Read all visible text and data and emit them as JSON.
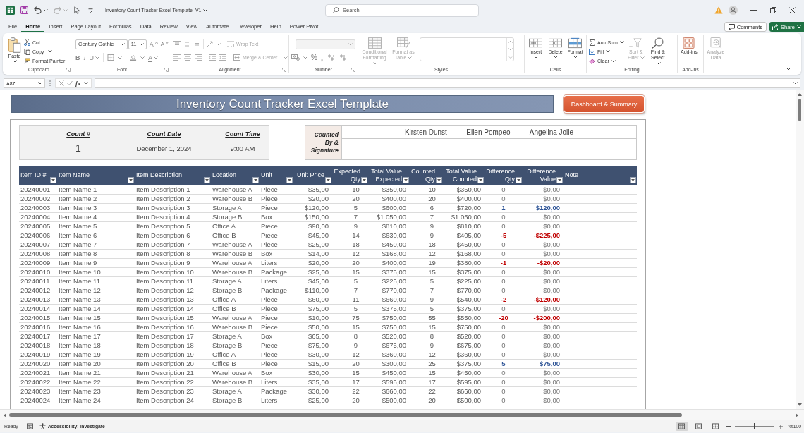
{
  "title_bar": {
    "title": "Inventory Count Tracker Excel Template_V1",
    "redo_disabled": true,
    "search": {
      "placeholder": "Search"
    }
  },
  "menu": {
    "tabs": [
      {
        "label": "File",
        "selected": false
      },
      {
        "label": "Home",
        "selected": true
      },
      {
        "label": "Insert",
        "selected": false
      },
      {
        "label": "Page Layout",
        "selected": false
      },
      {
        "label": "Formulas",
        "selected": false
      },
      {
        "label": "Data",
        "selected": false
      },
      {
        "label": "Review",
        "selected": false
      },
      {
        "label": "View",
        "selected": false
      },
      {
        "label": "Automate",
        "selected": false
      },
      {
        "label": "Developer",
        "selected": false
      },
      {
        "label": "Help",
        "selected": false
      },
      {
        "label": "Power Pivot",
        "selected": false
      }
    ],
    "comments": "Comments",
    "share": "Share"
  },
  "ribbon": {
    "clipboard": {
      "label": "Clipboard",
      "paste": "Paste",
      "cut": "Cut",
      "copy": "Copy",
      "format_painter": "Format Painter"
    },
    "font": {
      "label": "Font",
      "family": "Century Gothic",
      "size": "11",
      "grow": "A",
      "shrink": "A",
      "bold": "B",
      "italic": "I",
      "underline": "U",
      "paint": "A"
    },
    "alignment": {
      "label": "Alignment",
      "wrap_text": {
        "label": "Wrap Text",
        "disabled": true
      },
      "merge": {
        "label": "Merge & Center",
        "disabled": true
      }
    },
    "number": {
      "label": "Number",
      "format_disabled": true,
      "percent": "%",
      "comma": ","
    },
    "styles": {
      "label": "Styles",
      "buttons": [
        {
          "label": "Conditional Formatting",
          "disabled": true
        },
        {
          "label": "Format as Table",
          "disabled": true
        }
      ]
    },
    "cells": {
      "label": "Cells",
      "buttons": [
        {
          "label": "Insert"
        },
        {
          "label": "Delete"
        },
        {
          "label": "Format"
        }
      ]
    },
    "editing": {
      "label": "Editing",
      "small": [
        {
          "label": "AutoSum"
        },
        {
          "label": "Fill"
        },
        {
          "label": "Clear"
        }
      ],
      "buttons": [
        {
          "label": "Sort & Filter",
          "disabled": true
        },
        {
          "label": "Find & Select",
          "disabled": false
        }
      ]
    },
    "addins": {
      "label": "Add-ins",
      "button": "Add-ins"
    },
    "analyze": {
      "label": "Analyze Data",
      "disabled": true
    }
  },
  "formula_bar": {
    "name_box": "A87",
    "function_label": "fx"
  },
  "sheet": {
    "banner": "Inventory Count Tracker Excel Template",
    "dashboard_button": "Dashboard & Summary",
    "count_info": [
      {
        "label": "Count #",
        "value": "1"
      },
      {
        "label": "Count Date",
        "value": "December 1, 2024"
      },
      {
        "label": "Count Time",
        "value": "9:00 AM"
      }
    ],
    "signature": {
      "label": "Counted By & Signature",
      "names": [
        {
          "kind": "name",
          "text": "Kirsten Dunst"
        },
        {
          "kind": "separator",
          "text": "-"
        },
        {
          "kind": "name",
          "text": "Ellen Pompeo"
        },
        {
          "kind": "separator",
          "text": "-"
        },
        {
          "kind": "name",
          "text": "Angelina Jolie"
        }
      ]
    },
    "table": {
      "columns": [
        {
          "label": "Item ID #",
          "kind": "id"
        },
        {
          "label": "Item Name",
          "kind": "text"
        },
        {
          "label": "Item Description",
          "kind": "text"
        },
        {
          "label": "Location",
          "kind": "text"
        },
        {
          "label": "Unit",
          "kind": "text"
        },
        {
          "label": "Unit Price",
          "kind": "money"
        },
        {
          "label": "Expected Qty",
          "kind": "number"
        },
        {
          "label": "Total Value Expected",
          "kind": "money"
        },
        {
          "label": "Counted Qty",
          "kind": "number"
        },
        {
          "label": "Total Value Counted",
          "kind": "money"
        },
        {
          "label": "Difference Qty",
          "kind": "diff_number"
        },
        {
          "label": "Difference Value",
          "kind": "diff_money"
        },
        {
          "label": "Note",
          "kind": "note"
        }
      ],
      "rows": [
        {
          "cells": [
            "20240001",
            "Item Name 1",
            "Item Description 1",
            "Warehouse A",
            "Piece",
            "$35,00",
            "10",
            "$350,00",
            "10",
            "$350,00",
            "0",
            "$0,00"
          ],
          "shortage": false,
          "surplus": false
        },
        {
          "cells": [
            "20240002",
            "Item Name 2",
            "Item Description 2",
            "Warehouse B",
            "Piece",
            "$20,00",
            "20",
            "$400,00",
            "20",
            "$400,00",
            "0",
            "$0,00"
          ],
          "shortage": false,
          "surplus": false
        },
        {
          "cells": [
            "20240003",
            "Item Name 3",
            "Item Description 3",
            "Storage A",
            "Piece",
            "$120,00",
            "5",
            "$600,00",
            "6",
            "$720,00",
            "1",
            "$120,00"
          ],
          "shortage": false,
          "surplus": true
        },
        {
          "cells": [
            "20240004",
            "Item Name 4",
            "Item Description 4",
            "Storage B",
            "Box",
            "$150,00",
            "7",
            "$1.050,00",
            "7",
            "$1.050,00",
            "0",
            "$0,00"
          ],
          "shortage": false,
          "surplus": false
        },
        {
          "cells": [
            "20240005",
            "Item Name 5",
            "Item Description 5",
            "Office A",
            "Piece",
            "$90,00",
            "9",
            "$810,00",
            "9",
            "$810,00",
            "0",
            "$0,00"
          ],
          "shortage": false,
          "surplus": false
        },
        {
          "cells": [
            "20240006",
            "Item Name 6",
            "Item Description 6",
            "Office B",
            "Piece",
            "$45,00",
            "14",
            "$630,00",
            "9",
            "$405,00",
            "-5",
            "-$225,00"
          ],
          "shortage": true,
          "surplus": false
        },
        {
          "cells": [
            "20240007",
            "Item Name 7",
            "Item Description 7",
            "Warehouse A",
            "Piece",
            "$25,00",
            "18",
            "$450,00",
            "18",
            "$450,00",
            "0",
            "$0,00"
          ],
          "shortage": false,
          "surplus": false
        },
        {
          "cells": [
            "20240008",
            "Item Name 8",
            "Item Description 8",
            "Warehouse B",
            "Box",
            "$14,00",
            "12",
            "$168,00",
            "12",
            "$168,00",
            "0",
            "$0,00"
          ],
          "shortage": false,
          "surplus": false
        },
        {
          "cells": [
            "20240009",
            "Item Name 9",
            "Item Description 9",
            "Warehouse A",
            "Liters",
            "$20,00",
            "20",
            "$400,00",
            "19",
            "$380,00",
            "-1",
            "-$20,00"
          ],
          "shortage": true,
          "surplus": false
        },
        {
          "cells": [
            "20240010",
            "Item Name 10",
            "Item Description 10",
            "Warehouse B",
            "Package",
            "$25,00",
            "15",
            "$375,00",
            "15",
            "$375,00",
            "0",
            "$0,00"
          ],
          "shortage": false,
          "surplus": false
        },
        {
          "cells": [
            "20240011",
            "Item Name 11",
            "Item Description 11",
            "Storage A",
            "Liters",
            "$45,00",
            "5",
            "$225,00",
            "5",
            "$225,00",
            "0",
            "$0,00"
          ],
          "shortage": false,
          "surplus": false
        },
        {
          "cells": [
            "20240012",
            "Item Name 12",
            "Item Description 12",
            "Storage B",
            "Package",
            "$110,00",
            "7",
            "$770,00",
            "7",
            "$770,00",
            "0",
            "$0,00"
          ],
          "shortage": false,
          "surplus": false
        },
        {
          "cells": [
            "20240013",
            "Item Name 13",
            "Item Description 13",
            "Office A",
            "Piece",
            "$60,00",
            "11",
            "$660,00",
            "9",
            "$540,00",
            "-2",
            "-$120,00"
          ],
          "shortage": true,
          "surplus": false
        },
        {
          "cells": [
            "20240014",
            "Item Name 14",
            "Item Description 14",
            "Office B",
            "Piece",
            "$75,00",
            "5",
            "$375,00",
            "5",
            "$375,00",
            "0",
            "$0,00"
          ],
          "shortage": false,
          "surplus": false
        },
        {
          "cells": [
            "20240015",
            "Item Name 15",
            "Item Description 15",
            "Warehouse A",
            "Piece",
            "$10,00",
            "75",
            "$750,00",
            "55",
            "$550,00",
            "-20",
            "-$200,00"
          ],
          "shortage": true,
          "surplus": false
        },
        {
          "cells": [
            "20240016",
            "Item Name 16",
            "Item Description 16",
            "Warehouse B",
            "Piece",
            "$50,00",
            "15",
            "$750,00",
            "15",
            "$750,00",
            "0",
            "$0,00"
          ],
          "shortage": false,
          "surplus": false
        },
        {
          "cells": [
            "20240017",
            "Item Name 17",
            "Item Description 17",
            "Storage A",
            "Box",
            "$65,00",
            "8",
            "$520,00",
            "8",
            "$520,00",
            "0",
            "$0,00"
          ],
          "shortage": false,
          "surplus": false
        },
        {
          "cells": [
            "20240018",
            "Item Name 18",
            "Item Description 18",
            "Storage B",
            "Piece",
            "$75,00",
            "9",
            "$675,00",
            "9",
            "$675,00",
            "0",
            "$0,00"
          ],
          "shortage": false,
          "surplus": false
        },
        {
          "cells": [
            "20240019",
            "Item Name 19",
            "Item Description 19",
            "Office A",
            "Piece",
            "$30,00",
            "12",
            "$360,00",
            "12",
            "$360,00",
            "0",
            "$0,00"
          ],
          "shortage": false,
          "surplus": false
        },
        {
          "cells": [
            "20240020",
            "Item Name 20",
            "Item Description 20",
            "Office B",
            "Piece",
            "$15,00",
            "20",
            "$300,00",
            "25",
            "$375,00",
            "5",
            "$75,00"
          ],
          "shortage": false,
          "surplus": true
        },
        {
          "cells": [
            "20240021",
            "Item Name 21",
            "Item Description 21",
            "Warehouse A",
            "Box",
            "$30,00",
            "15",
            "$450,00",
            "15",
            "$450,00",
            "0",
            "$0,00"
          ],
          "shortage": false,
          "surplus": false
        },
        {
          "cells": [
            "20240022",
            "Item Name 22",
            "Item Description 22",
            "Warehouse B",
            "Liters",
            "$35,00",
            "17",
            "$595,00",
            "17",
            "$595,00",
            "0",
            "$0,00"
          ],
          "shortage": false,
          "surplus": false
        },
        {
          "cells": [
            "20240023",
            "Item Name 23",
            "Item Description 23",
            "Storage A",
            "Package",
            "$30,00",
            "22",
            "$660,00",
            "22",
            "$660,00",
            "0",
            "$0,00"
          ],
          "shortage": false,
          "surplus": false
        },
        {
          "cells": [
            "20240024",
            "Item Name 24",
            "Item Description 24",
            "Storage B",
            "Liters",
            "$25,00",
            "20",
            "$500,00",
            "20",
            "$500,00",
            "0",
            "$0,00"
          ],
          "shortage": false,
          "surplus": false
        }
      ]
    }
  },
  "status_bar": {
    "status": "Ready",
    "accessibility": "Accessibility: Investigate",
    "views": [
      {
        "selected": true
      },
      {
        "selected": false
      },
      {
        "selected": false
      }
    ],
    "zoom_slider": {
      "level": 0.5
    },
    "zoom": "%100"
  }
}
